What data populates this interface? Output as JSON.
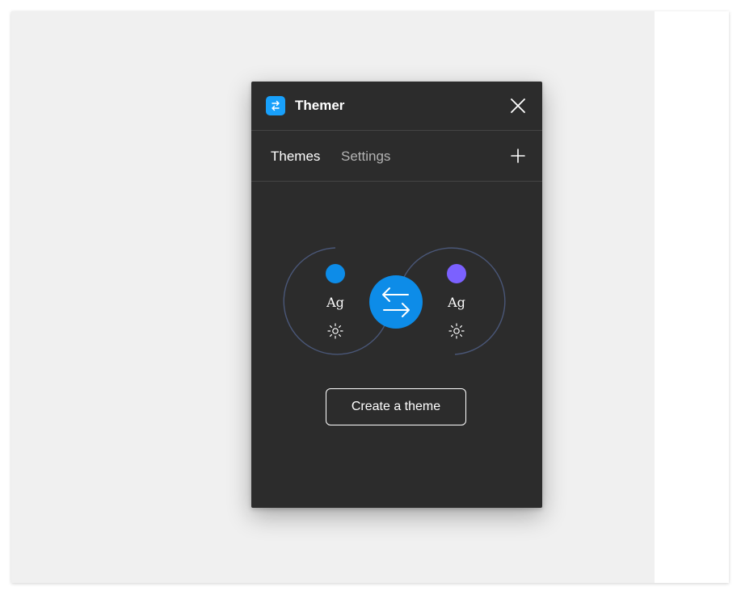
{
  "plugin": {
    "title": "Themer",
    "tabs": [
      {
        "label": "Themes",
        "active": true
      },
      {
        "label": "Settings",
        "active": false
      }
    ],
    "illustration": {
      "left_theme": {
        "sample_text": "Ag",
        "dot_color": "#0d8ce8",
        "icon": "sun-icon"
      },
      "right_theme": {
        "sample_text": "Ag",
        "dot_color": "#7b61ff",
        "icon": "sun-icon"
      },
      "center_icon": "swap-arrows-icon",
      "center_color": "#0d8ce8"
    },
    "create_button_label": "Create a theme"
  },
  "colors": {
    "panel_bg": "#2c2c2c",
    "accent": "#18a0fb",
    "canvas_bg": "#f0f0f0"
  }
}
